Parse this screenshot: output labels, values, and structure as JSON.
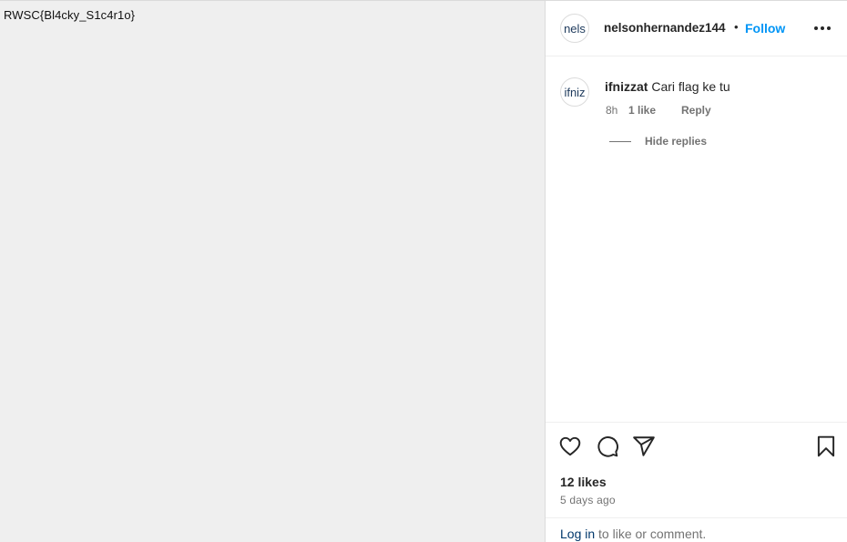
{
  "media": {
    "caption": "RWSC{Bl4cky_S1c4r1o}"
  },
  "post_header": {
    "avatar_text": "nels",
    "username": "nelsonhernandez144",
    "separator": "•",
    "follow_label": "Follow",
    "more_icon": "more-horizontal-icon"
  },
  "comment": {
    "avatar_text": "ifniz",
    "author": "ifnizzat",
    "text": "Cari flag ke tu",
    "time": "8h",
    "likes": "1 like",
    "reply_label": "Reply",
    "hide_replies_label": "Hide replies"
  },
  "actions": {
    "icons": [
      "heart-icon",
      "comment-icon",
      "share-icon",
      "bookmark-icon"
    ],
    "likes": "12 likes",
    "time_ago": "5 days ago",
    "login_link": "Log in",
    "login_suffix": " to like or comment."
  },
  "colors": {
    "accent": "#0095f6",
    "link": "#00376b",
    "muted": "#737373",
    "media_bg": "#efefef"
  }
}
